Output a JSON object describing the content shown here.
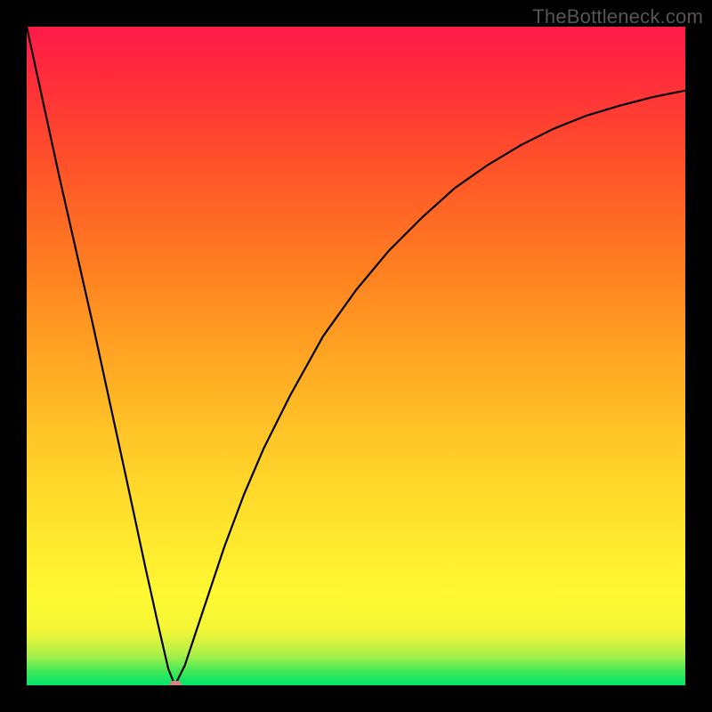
{
  "watermark": "TheBottleneck.com",
  "chart_data": {
    "type": "line",
    "title": "",
    "xlabel": "",
    "ylabel": "",
    "xlim": [
      0,
      100
    ],
    "ylim": [
      0,
      100
    ],
    "grid": false,
    "legend": false,
    "series": [
      {
        "name": "bottleneck-curve",
        "x": [
          0,
          5,
          10,
          15,
          18,
          20,
          21.5,
          22.5,
          24,
          26,
          28,
          30,
          33,
          36,
          40,
          45,
          50,
          55,
          60,
          65,
          70,
          75,
          80,
          85,
          90,
          95,
          100
        ],
        "values": [
          100,
          77,
          55,
          32,
          18,
          9,
          2.5,
          0,
          3,
          9,
          15,
          21,
          29,
          36,
          44,
          53,
          60,
          66,
          71,
          75.5,
          79,
          82,
          84.5,
          86.5,
          88,
          89.3,
          90.3
        ]
      }
    ],
    "marker": {
      "x": 22.5,
      "y": 0
    },
    "background_gradient": {
      "stops": [
        {
          "pos": 0.0,
          "color": "#00e46a"
        },
        {
          "pos": 0.08,
          "color": "#f4f636"
        },
        {
          "pos": 0.55,
          "color": "#ff9a22"
        },
        {
          "pos": 1.0,
          "color": "#ff1a4a"
        }
      ]
    }
  }
}
